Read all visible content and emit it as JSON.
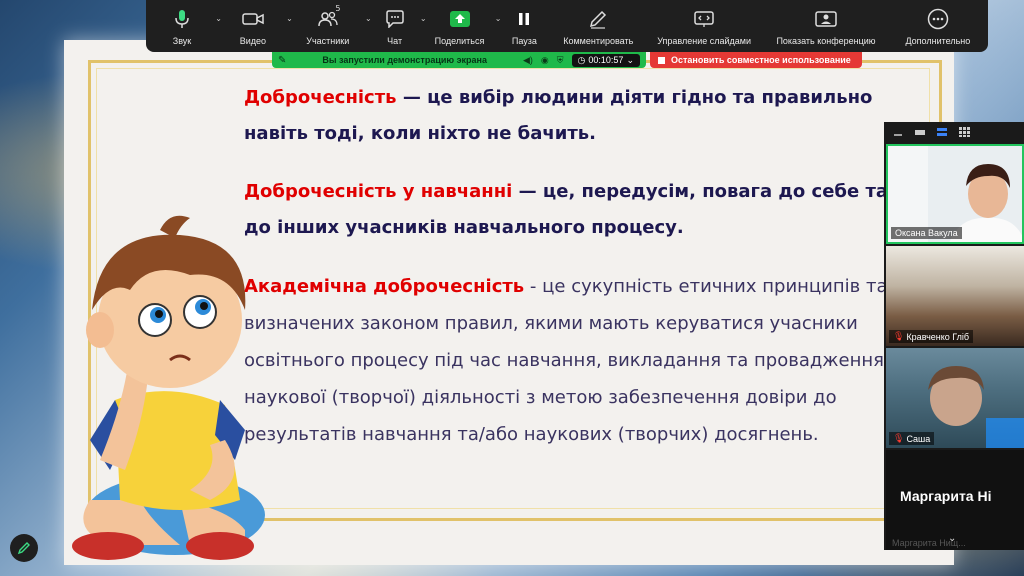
{
  "toolbar": {
    "items": [
      {
        "id": "audio",
        "label": "Звук",
        "icon": "microphone-icon",
        "caret": "⌄"
      },
      {
        "id": "video",
        "label": "Видео",
        "icon": "video-camera-icon",
        "caret": "⌄"
      },
      {
        "id": "participants",
        "label": "Участники",
        "icon": "participants-icon",
        "count": "5",
        "caret": "⌄"
      },
      {
        "id": "chat",
        "label": "Чат",
        "icon": "chat-icon",
        "caret": "⌄"
      },
      {
        "id": "share",
        "label": "Поделиться",
        "icon": "share-screen-icon",
        "caret": "⌄"
      },
      {
        "id": "pause",
        "label": "Пауза",
        "icon": "pause-icon"
      },
      {
        "id": "annotate",
        "label": "Комментировать",
        "icon": "pencil-icon"
      },
      {
        "id": "slides",
        "label": "Управление слайдами",
        "icon": "slides-control-icon"
      },
      {
        "id": "show_meeting",
        "label": "Показать конференцию",
        "icon": "show-meeting-icon"
      },
      {
        "id": "more",
        "label": "Дополнительно",
        "icon": "more-icon"
      }
    ]
  },
  "share_banner": {
    "text": "Вы запустили демонстрацию экрана",
    "timer": "00:10:57",
    "stop_label": "Остановить совместное использование",
    "colors": {
      "banner": "#1fb94a",
      "stop": "#e53935"
    }
  },
  "slide": {
    "paragraphs": [
      {
        "term": "Доброчесність",
        "separator": " — ",
        "rest": " це вибір людини  діяти гідно  та правильно навіть тоді, коли  ніхто не бачить."
      },
      {
        "term": "Доброчесність у навчанні",
        "separator": " — ",
        "rest": "це, передусім, повага до себе та до інших учасників навчального процесу."
      },
      {
        "term": "Академічна доброчесність",
        "separator": " - ",
        "rest": "це сукупність етичних принципів та визначених законом правил, якими мають керуватися учасники освітнього процесу під час навчання, викладання та провадження наукової (творчої) діяльності з метою забезпечення довіри до результатів навчання та/або наукових (творчих) досягнень."
      }
    ],
    "colors": {
      "term": "#e00000",
      "text": "#1d1850",
      "frame": "#e1c26a"
    }
  },
  "panel": {
    "participants": [
      {
        "name": "Оксана Вакула",
        "muted": false
      },
      {
        "name": "Кравченко Гліб",
        "muted": true
      },
      {
        "name": "Саша",
        "muted": true
      },
      {
        "name": "Маргарита  Ні",
        "muted": false,
        "video": false
      }
    ],
    "faint_label": "Маргарита Нищ...",
    "chevron": "⌄"
  }
}
